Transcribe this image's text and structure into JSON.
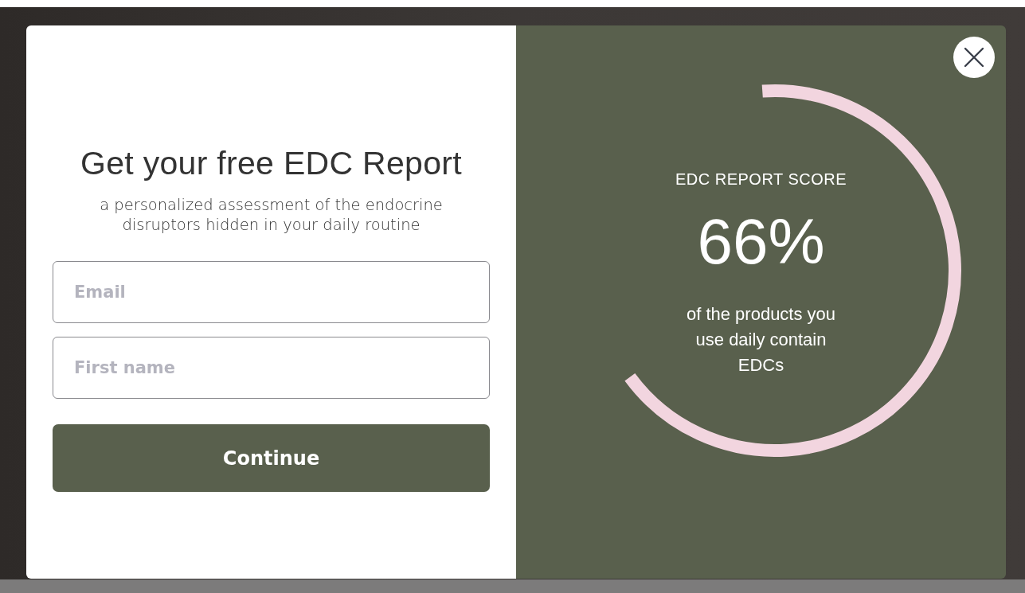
{
  "modal": {
    "title": "Get your free EDC Report",
    "subtitle": "a personalized assessment of the endocrine disruptors hidden in your daily routine",
    "fields": [
      {
        "placeholder": "Email"
      },
      {
        "placeholder": "First name"
      }
    ],
    "button": "Continue",
    "score": {
      "heading": "EDC REPORT SCORE",
      "value": "66%",
      "level": 0.66,
      "caption": "of the products you use daily contain EDCs"
    }
  }
}
